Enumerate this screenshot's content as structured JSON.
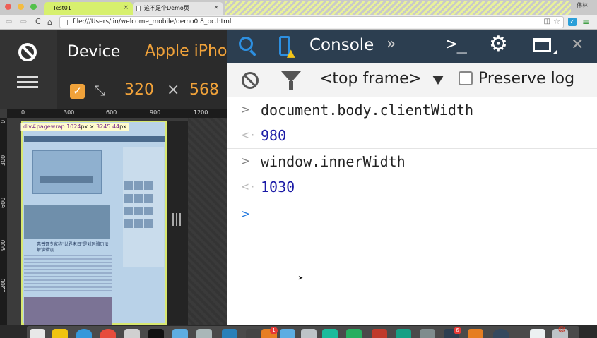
{
  "browser": {
    "tabs": [
      {
        "label": "Test01",
        "active": true
      },
      {
        "label": "这不是个Demo页",
        "active": false
      }
    ],
    "user_label": "伟林",
    "url": "file:///Users/lin/welcome_mobile/demo0.8_pc.html"
  },
  "emulator": {
    "device_label": "Device",
    "device_model": "Apple iPho",
    "fit_checked": true,
    "width": "320",
    "times": "×",
    "height": "568",
    "ruler_top": [
      "0",
      "300",
      "600",
      "900",
      "1200"
    ],
    "ruler_left": [
      "0",
      "300",
      "600",
      "900",
      "1200"
    ],
    "highlight": {
      "selector": "div#pagewrap",
      "width": "1024",
      "unit_w": "px",
      "times": "×",
      "height": "3245.44",
      "unit_h": "px"
    },
    "site_headline": "惠普哥专家称\"世界末日\"是对玛雅历法解读错误"
  },
  "devtools": {
    "panel_tab": "Console",
    "more_glyph": "»",
    "frame_selector": "<top frame>",
    "preserve_log_label": "Preserve log",
    "preserve_log_checked": false,
    "console_lines": [
      {
        "input": "document.body.clientWidth",
        "output": "980"
      },
      {
        "input": "window.innerWidth",
        "output": "1030"
      }
    ]
  },
  "dock": {
    "badges": [
      "1",
      "6"
    ]
  },
  "colors": {
    "accent_orange": "#f0a23a",
    "devtools_blue": "#2d8fe0",
    "result_blue": "#1a1aa6",
    "active_tab": "#d7f06e"
  }
}
